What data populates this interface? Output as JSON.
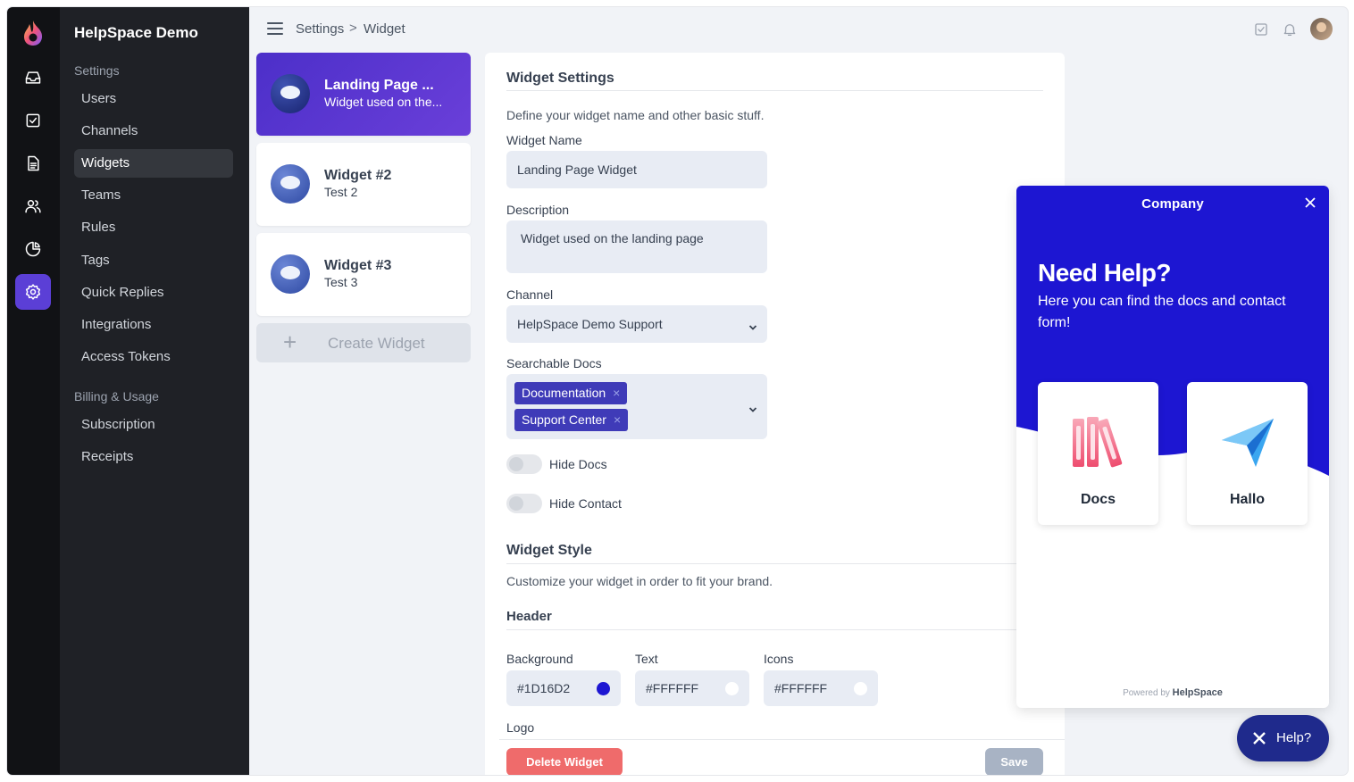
{
  "app": {
    "title": "HelpSpace Demo"
  },
  "rail": {
    "items": [
      {
        "name": "inbox-icon"
      },
      {
        "name": "tasks-icon"
      },
      {
        "name": "document-icon"
      },
      {
        "name": "users-icon"
      },
      {
        "name": "reports-icon"
      },
      {
        "name": "settings-icon",
        "active": true
      }
    ]
  },
  "sidebar": {
    "section_settings": "Settings",
    "items": [
      "Users",
      "Channels",
      "Widgets",
      "Teams",
      "Rules",
      "Tags",
      "Quick Replies",
      "Integrations",
      "Access Tokens"
    ],
    "section_billing": "Billing & Usage",
    "billing_items": [
      "Subscription",
      "Receipts"
    ]
  },
  "breadcrumb": {
    "root": "Settings",
    "separator": ">",
    "current": "Widget"
  },
  "widgets": [
    {
      "title": "Landing Page ...",
      "subtitle": "Widget used on the...",
      "active": true
    },
    {
      "title": "Widget #2",
      "subtitle": "Test 2"
    },
    {
      "title": "Widget #3",
      "subtitle": "Test 3"
    }
  ],
  "create_widget": {
    "plus": "+",
    "label": "Create Widget"
  },
  "settings": {
    "title": "Widget Settings",
    "description": "Define your widget name and other basic stuff.",
    "name_label": "Widget Name",
    "name_value": "Landing Page Widget",
    "desc_label": "Description",
    "desc_value": "Widget used on the landing page",
    "channel_label": "Channel",
    "channel_value": "HelpSpace Demo Support",
    "docs_label": "Searchable Docs",
    "docs_tags": [
      "Documentation",
      "Support Center"
    ],
    "tag_remove": "×",
    "hide_docs": "Hide Docs",
    "hide_contact": "Hide Contact"
  },
  "style": {
    "title": "Widget Style",
    "description": "Customize your widget in order to fit your brand.",
    "header_title": "Header",
    "background_label": "Background",
    "background_value": "#1D16D2",
    "text_label": "Text",
    "text_value": "#FFFFFF",
    "icons_label": "Icons",
    "icons_value": "#FFFFFF",
    "logo_label": "Logo"
  },
  "actions": {
    "delete": "Delete Widget",
    "save": "Save"
  },
  "preview": {
    "logo": "Company",
    "title": "Need Help?",
    "subtitle": "Here you can find the docs and contact form!",
    "card_docs": "Docs",
    "card_contact": "Hallo",
    "powered_by": "Powered by",
    "powered_brand": "HelpSpace"
  },
  "help_button": {
    "label": "Help?"
  },
  "colors": {
    "accent": "#5b3fd6",
    "widget_header": "#1D16D2",
    "delete": "#ef6b6b",
    "tag": "#3f3bb8"
  }
}
